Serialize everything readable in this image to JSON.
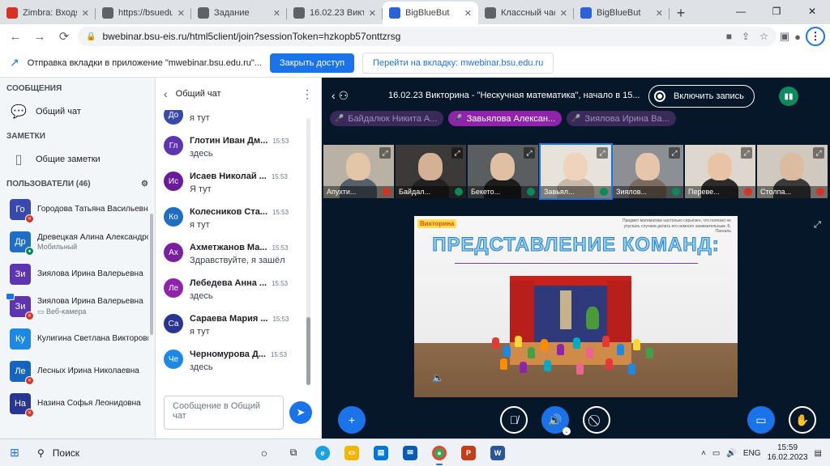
{
  "browser": {
    "tabs": [
      {
        "title": "Zimbra: Входя",
        "color": "#d93025",
        "active": false
      },
      {
        "title": "https://bsuedu",
        "color": "#5f6368",
        "active": false
      },
      {
        "title": "Задание",
        "color": "#5f6368",
        "active": false
      },
      {
        "title": "16.02.23 Викто",
        "color": "#5f6368",
        "active": false
      },
      {
        "title": "BigBlueBut",
        "color": "#2a62d8",
        "active": true
      },
      {
        "title": "Классный час",
        "color": "#5f6368",
        "active": false
      },
      {
        "title": "BigBlueBut",
        "color": "#2a62d8",
        "active": false
      }
    ],
    "url": "bwebinar.bsu-eis.ru/html5client/join?sessionToken=hzkopb57onttzrsg"
  },
  "infobar": {
    "message": "Отправка вкладки в приложение \"mwebinar.bsu.edu.ru\"...",
    "primary_button": "Закрыть доступ",
    "secondary_button": "Перейти на вкладку: mwebinar.bsu.edu.ru"
  },
  "left_panel": {
    "messages_title": "СООБЩЕНИЯ",
    "public_chat": "Общий чат",
    "notes_title": "ЗАМЕТКИ",
    "shared_notes": "Общие заметки",
    "users_title": "ПОЛЬЗОВАТЕЛИ (46)",
    "users": [
      {
        "initials": "Го",
        "name": "Городова Татьяна Васильевна",
        "sub": "",
        "color": "#3949ab",
        "mic": "muted",
        "presenter": false
      },
      {
        "initials": "Др",
        "name": "Древецкая Алина Александро...",
        "sub": "Мобильный",
        "color": "#1e6fc4",
        "mic": "on",
        "presenter": false
      },
      {
        "initials": "Зи",
        "name": "Зиялова Ирина Валерьевна",
        "sub": "",
        "color": "#5e35b1",
        "mic": "none",
        "presenter": false
      },
      {
        "initials": "Зи",
        "name": "Зиялова Ирина Валерьевна",
        "sub": "▭ Веб-камера",
        "color": "#5e35b1",
        "mic": "muted",
        "presenter": true
      },
      {
        "initials": "Ку",
        "name": "Кулигина Светлана Викторовна",
        "sub": "",
        "color": "#1e88e5",
        "mic": "none",
        "presenter": false
      },
      {
        "initials": "Ле",
        "name": "Лесных Ирина Николаевна",
        "sub": "",
        "color": "#1565c0",
        "mic": "muted",
        "presenter": false
      },
      {
        "initials": "На",
        "name": "Назина Софья Леонидовна",
        "sub": "",
        "color": "#283593",
        "mic": "muted",
        "presenter": false
      }
    ]
  },
  "chat": {
    "title": "Общий чат",
    "messages": [
      {
        "initials": "До",
        "name": "",
        "time": "",
        "text": "я тут",
        "color": "#3949ab"
      },
      {
        "initials": "Гл",
        "name": "Глотин Иван Дм...",
        "time": "15:53",
        "text": "здесь",
        "color": "#5e35b1"
      },
      {
        "initials": "Ис",
        "name": "Исаев Николай ...",
        "time": "15:53",
        "text": "Я тут",
        "color": "#6a1b9a"
      },
      {
        "initials": "Ко",
        "name": "Колесников Ста...",
        "time": "15:53",
        "text": "я тут",
        "color": "#1e6fc4"
      },
      {
        "initials": "Ах",
        "name": "Ахметжанов Ма...",
        "time": "15:53",
        "text": "Здравствуйте, я зашёл",
        "color": "#7b1fa2"
      },
      {
        "initials": "Ле",
        "name": "Лебедева Анна ...",
        "time": "15:53",
        "text": "здесь",
        "color": "#8e24aa"
      },
      {
        "initials": "Са",
        "name": "Сараева Мария ...",
        "time": "15:53",
        "text": "я тут",
        "color": "#283593"
      },
      {
        "initials": "Че",
        "name": "Черномурова Д...",
        "time": "15:53",
        "text": "здесь",
        "color": "#1e88e5"
      }
    ],
    "input_placeholder": "Сообщение в Общий чат"
  },
  "meeting": {
    "title": "16.02.23 Викторина - \"Нескучная математика\", начало в 15...",
    "record_label": "Включить запись",
    "talkers": [
      {
        "name": "Байдалюк Никита А...",
        "active": false
      },
      {
        "name": "Завьялова Алексан...",
        "active": true
      },
      {
        "name": "Зиялова Ирина Ва...",
        "active": false
      }
    ],
    "videos": [
      {
        "name": "Апухти...",
        "mic": "muted",
        "bg": "#b9b2a4",
        "skin": "#e3c6a8",
        "shirt": "#55606b",
        "active": false
      },
      {
        "name": "Байдал...",
        "mic": "on",
        "bg": "#3c3a38",
        "skin": "#d4b195",
        "shirt": "#222",
        "active": false
      },
      {
        "name": "Бекето...",
        "mic": "on",
        "bg": "#5a5e60",
        "skin": "#e0c0a2",
        "shirt": "#1d1d1d",
        "active": false
      },
      {
        "name": "Завьял...",
        "mic": "on",
        "bg": "#e7e3da",
        "skin": "#f0d3bd",
        "shirt": "#c9b9a8",
        "active": true
      },
      {
        "name": "Зиялов...",
        "mic": "on",
        "bg": "#8c8f94",
        "skin": "#e6c6aa",
        "shirt": "#7c6c60",
        "active": false
      },
      {
        "name": "Переве...",
        "mic": "muted",
        "bg": "#ddd7cf",
        "skin": "#e8c3a5",
        "shirt": "#2c2c2c",
        "active": false
      },
      {
        "name": "Столпа...",
        "mic": "muted",
        "bg": "#cfc9bf",
        "skin": "#dcbca0",
        "shirt": "#3a3a3a",
        "active": false
      }
    ],
    "slide": {
      "badge": "Викторина",
      "quote": "Предмет математики настолько серьёзен, что полезно не упускать случаев делать его немного занимательным. Б. Паскаль",
      "title": "ПРЕДСТАВЛЕНИЕ КОМАНД:"
    }
  },
  "taskbar": {
    "search": "Поиск",
    "lang": "ENG",
    "time": "15:59",
    "date": "16.02.2023"
  },
  "colors": {
    "accent": "#1a73e8",
    "meeting_bg": "#06172a",
    "talker_active": "#8e24aa",
    "talker_inactive": "#3a2a5a"
  }
}
